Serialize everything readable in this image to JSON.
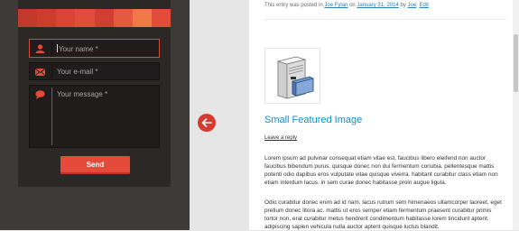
{
  "form": {
    "stripe_colors": [
      "#c0392b",
      "#cc3d2e",
      "#d94436",
      "#e04e3b",
      "#cf4033",
      "#e35a3f",
      "#ef7a48",
      "#e24c3a"
    ],
    "name_placeholder": "Your name *",
    "email_placeholder": "Your e-mail *",
    "message_placeholder": "Your message *",
    "send_label": "Send",
    "icons": [
      "user-icon",
      "envelope-icon",
      "speech-bubble-icon"
    ],
    "accent_color": "#e4493a"
  },
  "nav": {
    "back_icon": "left-arrow-icon"
  },
  "article": {
    "meta": {
      "prefix": "This entry was posted in",
      "category": "Joe Fylan",
      "on_text": "on",
      "date": "January 31, 2014",
      "by_text": "by",
      "author": "Joe",
      "sep": ".",
      "edit": "Edit"
    },
    "thumbnail_icon": "server-book-icon",
    "title": "Small Featured Image",
    "reply_link": "Leave a reply",
    "paragraph1": "Lorem ipsum ad pulvinar consequat etiam vitae est. faucibus libero eleifend non auctor faucibus bibendum purus. quisque donec non dui fermentum conubia. pellentesque mattis potenti odio dapibus eros vulputate vitae quisque viverra. habitant curabitur class etiam non etiam interdum lacus. in sem curae donec habitasse proin augue ligula.",
    "paragraph2": "Odio curabitur donec enim ad id nam. lacus rutrum sem himenaeos ullamcorper laoreet, eget pretium donec litora ac. mattis ut eros semper etiam fermentum praesent curabitur primis tortor non, erat curabitur metus hendrerit condimentum habitasse lorem tincidunt aptent. adipiscing sapien vehicula nulla auctor aptent quisque luctus blandit.",
    "link_color": "#1b8bc8"
  }
}
